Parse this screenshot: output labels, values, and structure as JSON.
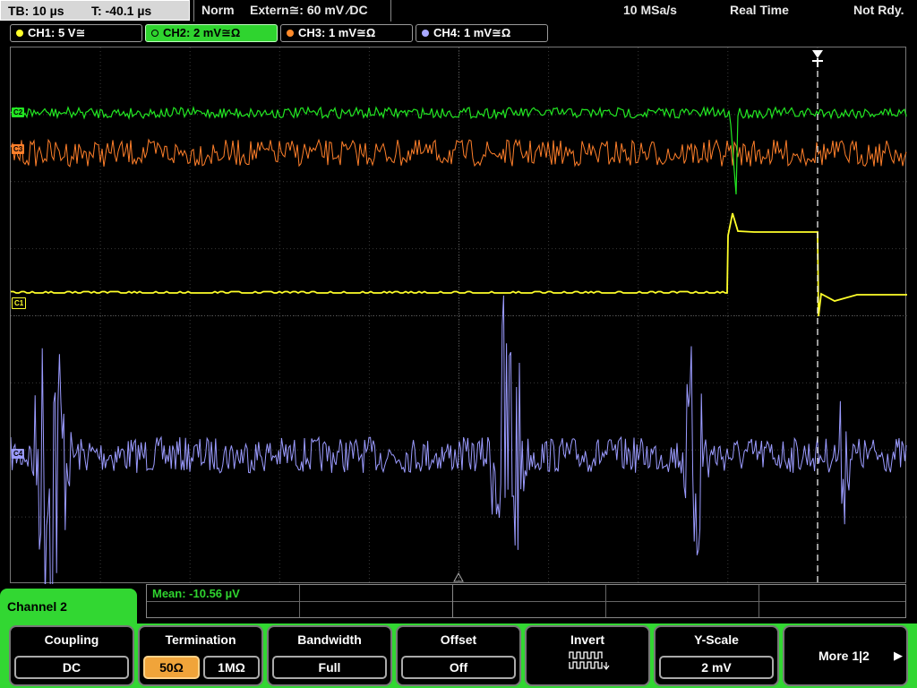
{
  "topbar": {
    "timebase": "TB: 10 µs",
    "trigger_time": "T: -40.1 µs",
    "trigger_mode": "Norm",
    "trigger_source": "Extern≅: 60 mV ⁄DC",
    "sample_rate": "10 MSa/s",
    "acq_mode": "Real Time",
    "status": "Not Rdy."
  },
  "channels": [
    {
      "label": "CH1: 5 V≅",
      "color": "#ffff2a",
      "active": false
    },
    {
      "label": "CH2: 2 mV≅Ω",
      "color": "#2fd42f",
      "active": true
    },
    {
      "label": "CH3: 1 mV≅Ω",
      "color": "#ff8a2a",
      "active": false
    },
    {
      "label": "CH4: 1 mV≅Ω",
      "color": "#a8a8ff",
      "active": false
    }
  ],
  "markers": {
    "c1": "C1",
    "c2": "C2",
    "c3": "C3",
    "c4": "C4"
  },
  "trace_colors": {
    "ch1": "#ffff2a",
    "ch2": "#22e622",
    "ch3": "#ff7f2a",
    "ch4": "#9b9bff"
  },
  "measurement": {
    "mean": "Mean: -10.56 µV"
  },
  "panel": {
    "title": "Channel 2",
    "coupling": {
      "title": "Coupling",
      "value": "DC"
    },
    "termination": {
      "title": "Termination",
      "opt1": "50Ω",
      "opt2": "1MΩ"
    },
    "bandwidth": {
      "title": "Bandwidth",
      "value": "Full"
    },
    "offset": {
      "title": "Offset",
      "value": "Off"
    },
    "invert": {
      "title": "Invert"
    },
    "yscale": {
      "title": "Y-Scale",
      "value": "2 mV"
    },
    "more": {
      "label": "More 1|2"
    }
  }
}
